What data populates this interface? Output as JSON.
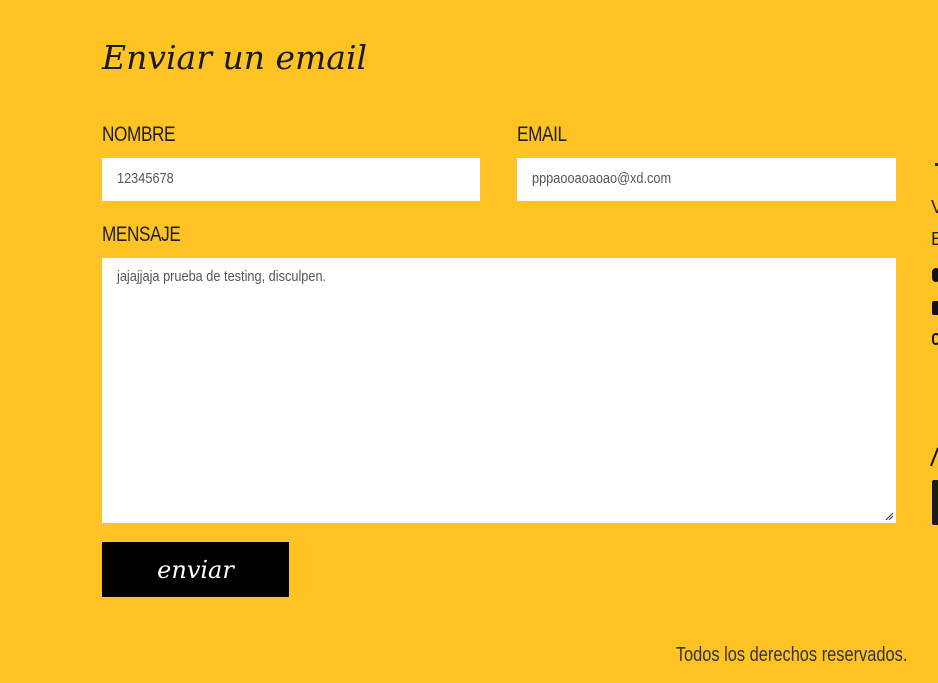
{
  "form": {
    "title": "Enviar un email",
    "name_label": "NOMBRE",
    "name_value": "12345678",
    "email_label": "EMAIL",
    "email_value": "pppaooaoaoao@xd.com",
    "message_label": "MENSAJE",
    "message_value": "jajajjaja prueba de testing, disculpen.",
    "submit_label": "enviar"
  },
  "footer": {
    "copyright": "Todos los derechos reservados."
  },
  "clipped_right": {
    "line1": "V",
    "line2": "E"
  },
  "colors": {
    "background": "#FFC423",
    "button": "#000000",
    "field": "#FFFFFF"
  }
}
